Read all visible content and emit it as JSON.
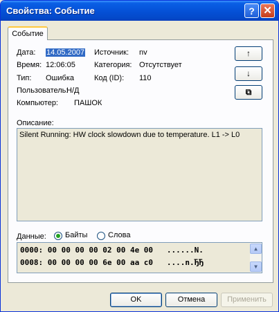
{
  "window": {
    "title": "Свойства: Событие",
    "help_glyph": "?",
    "close_glyph": "✕"
  },
  "tab": {
    "label": "Событие"
  },
  "fields": {
    "date_label": "Дата:",
    "date_value": "14.05.2007",
    "time_label": "Время:",
    "time_value": "12:06:05",
    "type_label": "Тип:",
    "type_value": "Ошибка",
    "user_label": "Пользователь:",
    "user_value": "Н/Д",
    "computer_label": "Компьютер:",
    "computer_value": "ПАШОК",
    "source_label": "Источник:",
    "source_value": "nv",
    "category_label": "Категория:",
    "category_value": "Отсутствует",
    "id_label": "Код (ID):",
    "id_value": "110"
  },
  "nav": {
    "up_glyph": "↑",
    "down_glyph": "↓",
    "copy_glyph": "⧉"
  },
  "description": {
    "label": "Описание:",
    "text": "Silent Running: HW clock slowdown due to temperature.  L1 -> L0"
  },
  "data_section": {
    "label": "Данные:",
    "options": [
      "Байты",
      "Слова"
    ],
    "selected": "Байты",
    "lines": [
      "0000: 00 00 00 00 02 00 4e 00   ......N.",
      "0008: 00 00 00 00 6e 00 aa c0   ....n.ЂЂ"
    ]
  },
  "buttons": {
    "ok": "OK",
    "cancel": "Отмена",
    "apply": "Применить"
  }
}
